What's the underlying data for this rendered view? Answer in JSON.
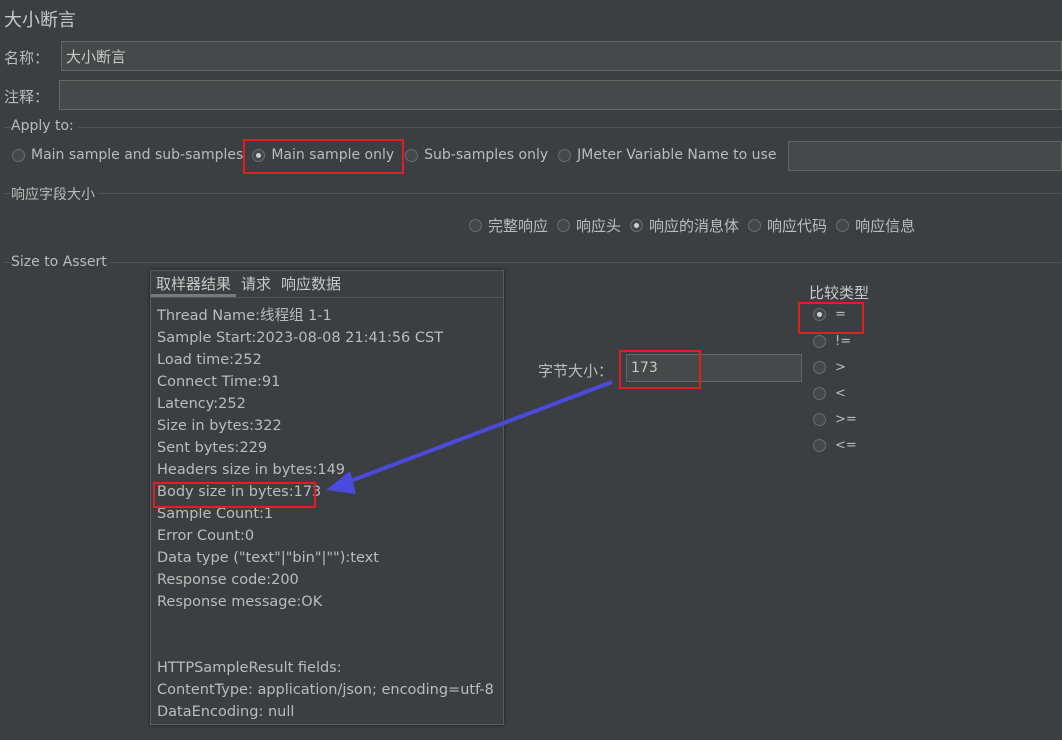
{
  "page": {
    "title": "大小断言"
  },
  "fields": {
    "name_label": "名称：",
    "name_value": "大小断言",
    "comment_label": "注释：",
    "comment_value": ""
  },
  "apply_to": {
    "title": "Apply to:",
    "options": [
      {
        "label": "Main sample and sub-samples",
        "checked": false
      },
      {
        "label": "Main sample only",
        "checked": true
      },
      {
        "label": "Sub-samples only",
        "checked": false
      },
      {
        "label": "JMeter Variable Name to use",
        "checked": false
      }
    ],
    "variable_value": ""
  },
  "response_field": {
    "title": "响应字段大小",
    "options": [
      {
        "label": "完整响应",
        "checked": false
      },
      {
        "label": "响应头",
        "checked": false
      },
      {
        "label": "响应的消息体",
        "checked": true
      },
      {
        "label": "响应代码",
        "checked": false
      },
      {
        "label": "响应信息",
        "checked": false
      }
    ]
  },
  "size_to_assert": {
    "title": "Size to Assert",
    "bytes_label": "字节大小：",
    "bytes_value": "173",
    "compare_title": "比较类型",
    "compare_options": [
      {
        "label": "=",
        "checked": true
      },
      {
        "label": "!=",
        "checked": false
      },
      {
        "label": ">",
        "checked": false
      },
      {
        "label": "<",
        "checked": false
      },
      {
        "label": ">=",
        "checked": false
      },
      {
        "label": "<=",
        "checked": false
      }
    ]
  },
  "sampler_panel": {
    "tabs": [
      {
        "label": "取样器结果",
        "active": true
      },
      {
        "label": "请求",
        "active": false
      },
      {
        "label": "响应数据",
        "active": false
      }
    ],
    "lines": [
      "Thread Name:线程组 1-1",
      "Sample Start:2023-08-08 21:41:56 CST",
      "Load time:252",
      "Connect Time:91",
      "Latency:252",
      "Size in bytes:322",
      "Sent bytes:229",
      "Headers size in bytes:149",
      "Body size in bytes:173",
      "Sample Count:1",
      "Error Count:0",
      "Data type (\"text\"|\"bin\"|\"\"):text",
      "Response code:200",
      "Response message:OK",
      "",
      "",
      "HTTPSampleResult fields:",
      "ContentType: application/json; encoding=utf-8",
      "DataEncoding: null"
    ]
  },
  "colors": {
    "highlight": "#e02020",
    "arrow": "#4a4adc"
  }
}
